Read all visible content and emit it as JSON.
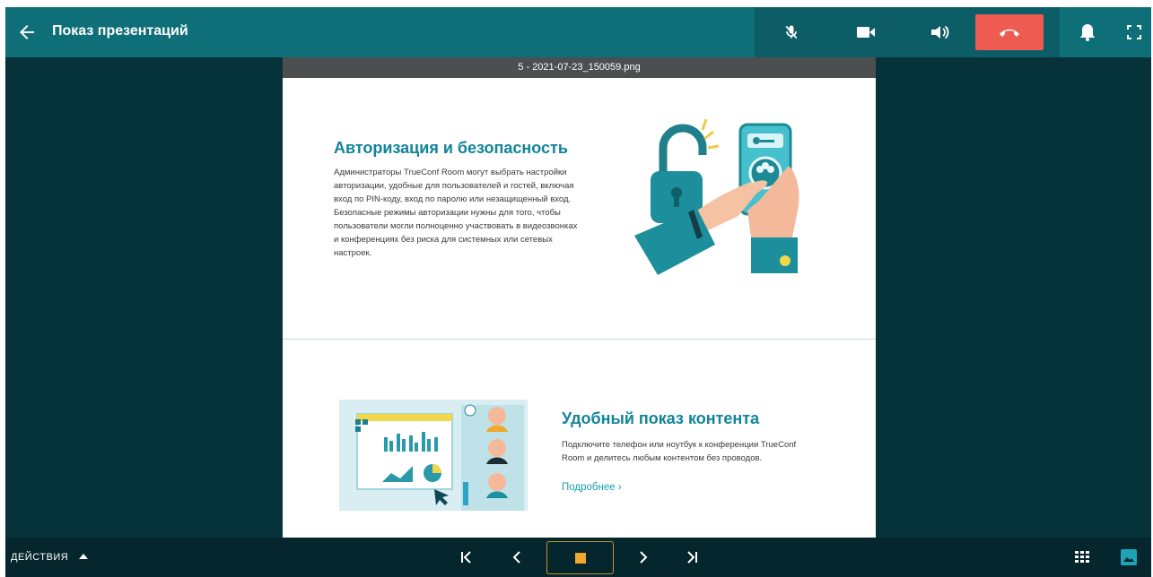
{
  "header": {
    "title": "Показ презентаций",
    "icons": [
      "arrow-left-icon",
      "mic-off-icon",
      "camera-icon",
      "speaker-icon",
      "hangup-icon",
      "bell-icon",
      "fullscreen-icon"
    ]
  },
  "file": {
    "name": "5 - 2021-07-23_150059.png"
  },
  "slide": {
    "section1": {
      "title": "Авторизация и безопасность",
      "lines": [
        "Администраторы TrueConf Room могут выбрать настройки",
        "авторизации, удобные для пользователей и гостей, включая",
        "вход по PIN-коду, вход по паролю или незащищенный вход.",
        "Безопасные режимы авторизации нужны для того, чтобы",
        "пользователи могли полноценно участвовать в видеозвонках",
        "и конференциях без риска для системных или сетевых",
        "настроек."
      ]
    },
    "section2": {
      "title": "Удобный показ контента",
      "lines": [
        "Подключите телефон или ноутбук к конференции TrueConf",
        "Room и делитесь любым контентом без проводов."
      ],
      "link": "Подробнее ›"
    }
  },
  "footer": {
    "actions_label": "ДЕЙСТВИЯ",
    "icons": [
      "first-page-icon",
      "prev-icon",
      "stop-icon",
      "next-icon",
      "last-page-icon",
      "grid-icon",
      "image-icon"
    ]
  },
  "colors": {
    "topbar": "#0f6f78",
    "background": "#06323a",
    "hangup": "#ee5b50",
    "accent": "#f0a830"
  }
}
